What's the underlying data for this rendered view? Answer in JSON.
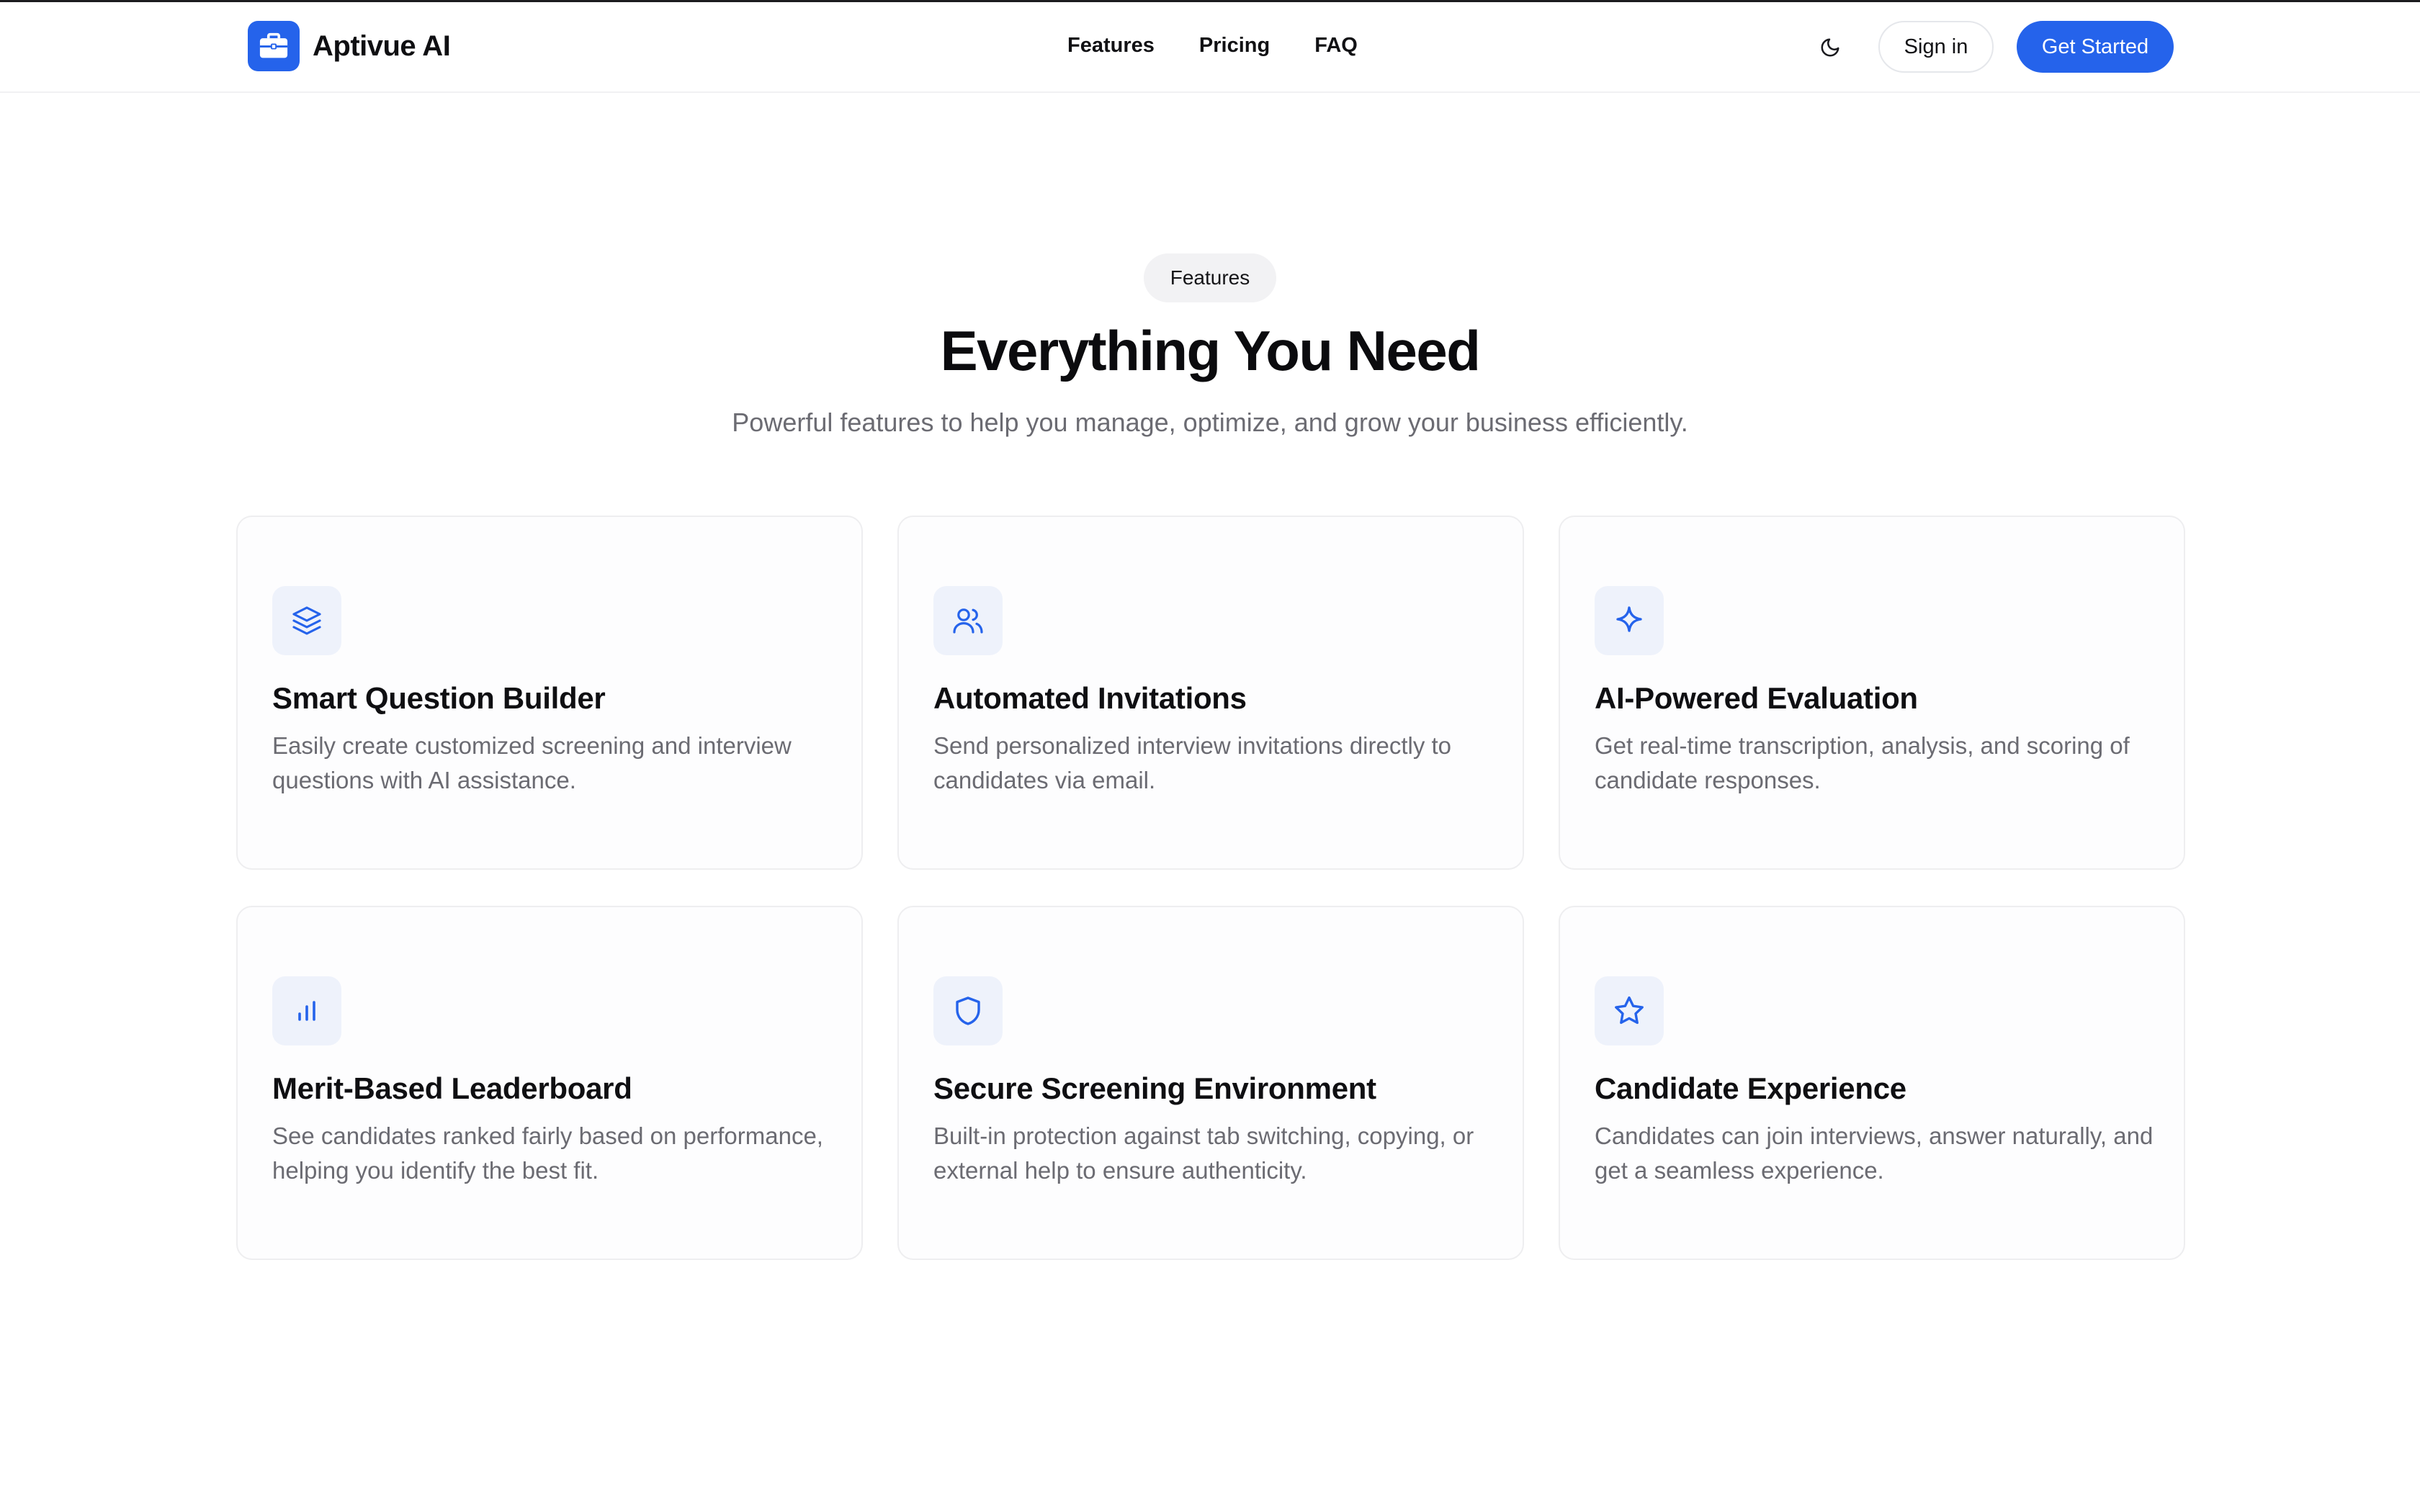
{
  "header": {
    "brand_name": "Aptivue AI",
    "nav": [
      "Features",
      "Pricing",
      "FAQ"
    ],
    "sign_in_label": "Sign in",
    "cta_label": "Get Started"
  },
  "section": {
    "pill_label": "Features",
    "title": "Everything You Need",
    "subtitle": "Powerful features to help you manage, optimize, and grow your business efficiently."
  },
  "features": [
    {
      "icon": "layers-icon",
      "title": "Smart Question Builder",
      "description": "Easily create customized screening and interview questions with AI assistance."
    },
    {
      "icon": "users-icon",
      "title": "Automated Invitations",
      "description": "Send personalized interview invitations directly to candidates via email."
    },
    {
      "icon": "sparkle-icon",
      "title": "AI-Powered Evaluation",
      "description": "Get real-time transcription, analysis, and scoring of candidate responses."
    },
    {
      "icon": "bar-chart-icon",
      "title": "Merit-Based Leaderboard",
      "description": "See candidates ranked fairly based on performance, helping you identify the best fit."
    },
    {
      "icon": "shield-icon",
      "title": "Secure Screening Environment",
      "description": "Built-in protection against tab switching, copying, or external help to ensure authenticity."
    },
    {
      "icon": "star-icon",
      "title": "Candidate Experience",
      "description": "Candidates can join interviews, answer naturally, and get a seamless experience."
    }
  ],
  "colors": {
    "accent": "#2563eb",
    "icon_bg": "#eef2fb",
    "muted_text": "#6b6b72"
  }
}
